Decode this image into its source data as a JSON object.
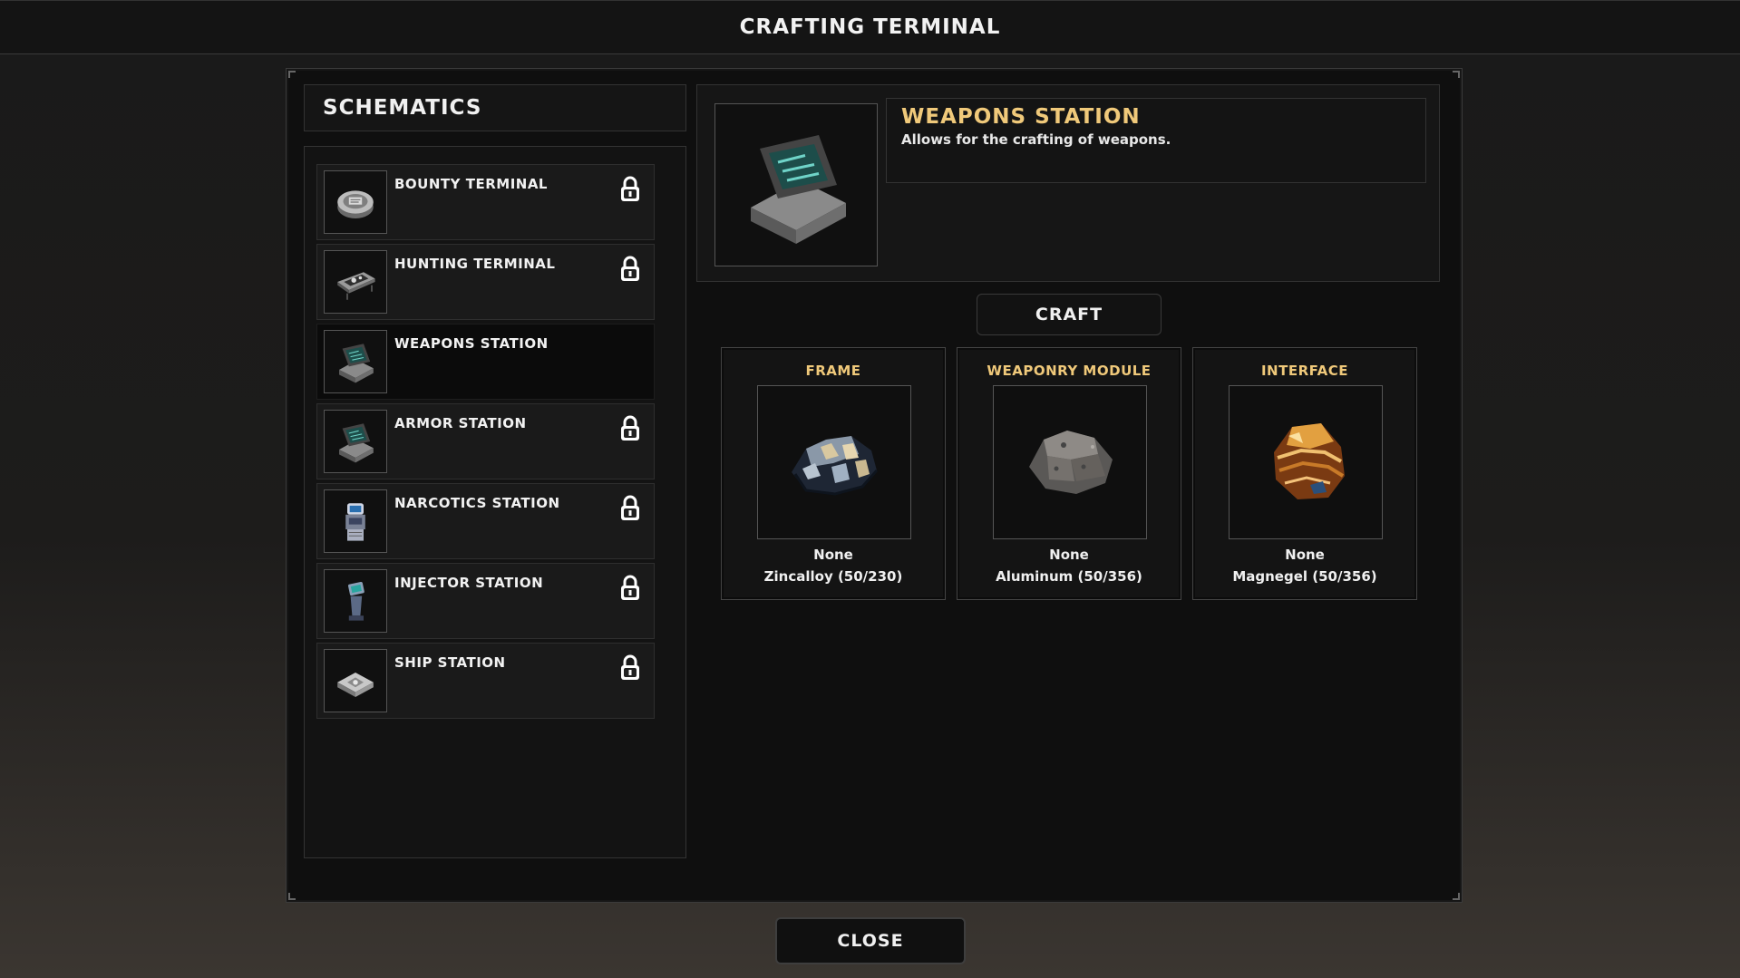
{
  "window": {
    "title": "CRAFTING TERMINAL"
  },
  "schematics": {
    "header": "SCHEMATICS",
    "items": [
      {
        "label": "BOUNTY TERMINAL",
        "locked": true,
        "icon": "bounty-terminal-icon"
      },
      {
        "label": "HUNTING TERMINAL",
        "locked": true,
        "icon": "hunting-terminal-icon"
      },
      {
        "label": "WEAPONS STATION",
        "locked": false,
        "selected": true,
        "icon": "weapons-station-icon"
      },
      {
        "label": "ARMOR STATION",
        "locked": true,
        "icon": "armor-station-icon"
      },
      {
        "label": "NARCOTICS STATION",
        "locked": true,
        "icon": "narcotics-station-icon"
      },
      {
        "label": "INJECTOR STATION",
        "locked": true,
        "icon": "injector-station-icon"
      },
      {
        "label": "SHIP STATION",
        "locked": true,
        "icon": "ship-station-icon"
      }
    ]
  },
  "detail": {
    "name": "WEAPONS STATION",
    "description": "Allows for the crafting of weapons.",
    "icon": "weapons-station-icon"
  },
  "craft_label": "CRAFT",
  "slots": [
    {
      "title": "FRAME",
      "selected": "None",
      "material": "Zincalloy (50/230)",
      "icon": "zincalloy-ore-icon"
    },
    {
      "title": "WEAPONRY MODULE",
      "selected": "None",
      "material": "Aluminum (50/356)",
      "icon": "aluminum-ore-icon"
    },
    {
      "title": "INTERFACE",
      "selected": "None",
      "material": "Magnegel (50/356)",
      "icon": "magnegel-ore-icon"
    }
  ],
  "close_label": "CLOSE",
  "colors": {
    "accent": "#f0c97a",
    "panel": "#0f0f0f",
    "border": "#3b3b3b"
  }
}
